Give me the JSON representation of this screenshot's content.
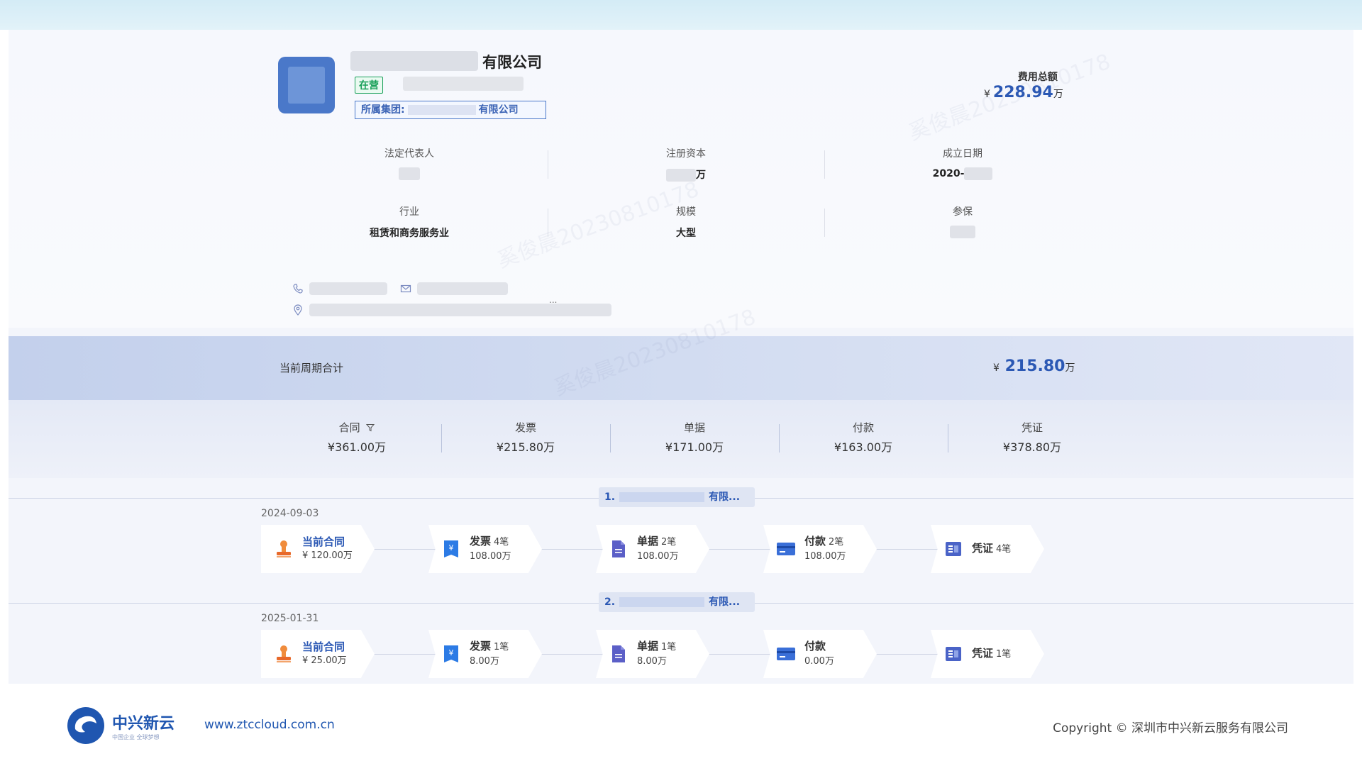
{
  "company": {
    "name_suffix": "有限公司",
    "status": "在营",
    "group_label": "所属集团:",
    "group_suffix": "有限公司",
    "fee_label": "费用总额",
    "fee_currency": "¥",
    "fee_value": "228.94",
    "fee_unit": "万",
    "info": [
      {
        "key": "法定代表人",
        "value": ""
      },
      {
        "key": "注册资本",
        "value": "万"
      },
      {
        "key": "成立日期",
        "value": "2020-"
      },
      {
        "key": "行业",
        "value": "租赁和商务服务业"
      },
      {
        "key": "规模",
        "value": "大型"
      },
      {
        "key": "参保",
        "value": ""
      }
    ],
    "ellipsis": "..."
  },
  "summary": {
    "label": "当前周期合计",
    "currency": "¥",
    "value": "215.80",
    "unit": "万"
  },
  "metrics": [
    {
      "label": "合同",
      "value": "¥361.00万",
      "has_filter": true
    },
    {
      "label": "发票",
      "value": "¥215.80万"
    },
    {
      "label": "单据",
      "value": "¥171.00万"
    },
    {
      "label": "付款",
      "value": "¥163.00万"
    },
    {
      "label": "凭证",
      "value": "¥378.80万"
    }
  ],
  "timelines": [
    {
      "index": "1.",
      "tag_suffix": "有限...",
      "date": "2024-09-03",
      "steps": [
        {
          "title": "当前合同",
          "count": "",
          "amount": "¥ 120.00万"
        },
        {
          "title": "发票",
          "count": "4笔",
          "amount": "108.00万"
        },
        {
          "title": "单据",
          "count": "2笔",
          "amount": "108.00万"
        },
        {
          "title": "付款",
          "count": "2笔",
          "amount": "108.00万"
        },
        {
          "title": "凭证",
          "count": "4笔",
          "amount": ""
        }
      ]
    },
    {
      "index": "2.",
      "tag_suffix": "有限...",
      "date": "2025-01-31",
      "steps": [
        {
          "title": "当前合同",
          "count": "",
          "amount": "¥ 25.00万"
        },
        {
          "title": "发票",
          "count": "1笔",
          "amount": "8.00万"
        },
        {
          "title": "单据",
          "count": "1笔",
          "amount": "8.00万"
        },
        {
          "title": "付款",
          "count": "",
          "amount": "0.00万"
        },
        {
          "title": "凭证",
          "count": "1笔",
          "amount": ""
        }
      ]
    }
  ],
  "footer": {
    "brand_name": "中兴新云",
    "brand_sub": "中国企业 全球梦想",
    "url": "www.ztccloud.com.cn",
    "copyright": "Copyright © 深圳市中兴新云服务有限公司"
  },
  "watermark": "奚俊晨20230810178",
  "colors": {
    "accent": "#2b58b4",
    "status_green": "#18a058",
    "logo_blue": "#4a78c9"
  }
}
